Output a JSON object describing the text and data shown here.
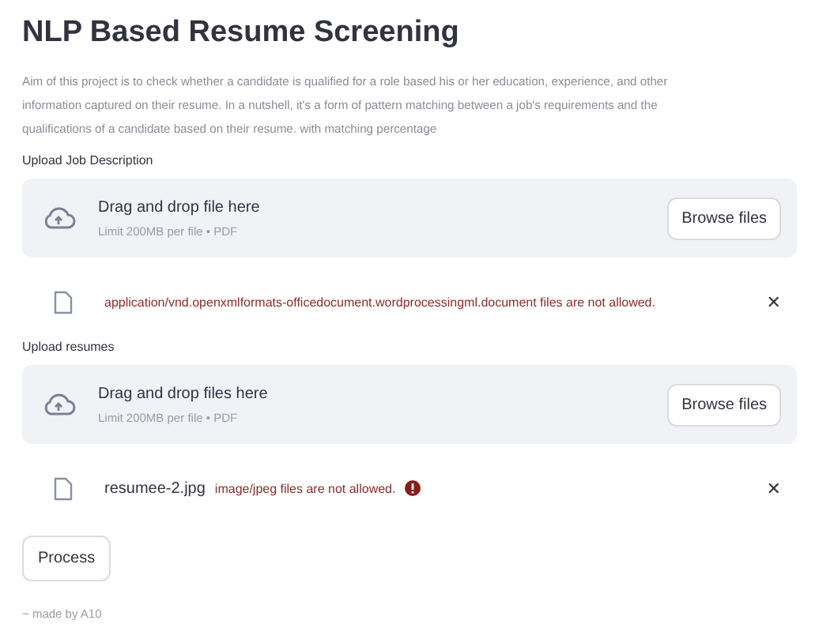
{
  "title": "NLP Based Resume Screening",
  "description_lines": [
    "Aim of this project is to check whether a candidate is qualified for a role based his or her education, experience, and other",
    "information captured on their resume. In a nutshell, it's a form of pattern matching between a job's requirements and the",
    "qualifications of a candidate based on their resume. with matching percentage"
  ],
  "uploaders": [
    {
      "label": "Upload Job Description",
      "drop_text": "Drag and drop file here",
      "limit_text": "Limit 200MB per file • PDF",
      "button": "Browse files",
      "file": {
        "error": "application/vnd.openxmlformats-officedocument.wordprocessingml.document files are not allowed.",
        "error_icon": false,
        "close": "✕"
      }
    },
    {
      "label": "Upload resumes",
      "drop_text": "Drag and drop files here",
      "limit_text": "Limit 200MB per file • PDF",
      "button": "Browse files",
      "file": {
        "name": "resumee-2.jpg",
        "error": "image/jpeg files are not allowed.",
        "error_icon": true,
        "close": "✕"
      }
    }
  ],
  "process_button": "Process",
  "footer": "~ made by A10"
}
